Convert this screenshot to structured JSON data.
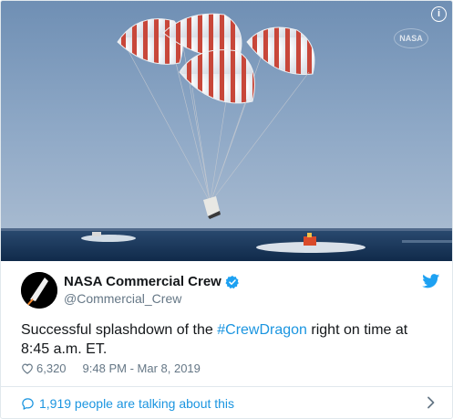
{
  "media": {
    "info_label": "i",
    "watermark_label": "NASA",
    "sky_color": "#8aa5c4",
    "sea_color": "#1a3a5f"
  },
  "author": {
    "name": "NASA Commercial Crew",
    "handle": "@Commercial_Crew",
    "verified": true
  },
  "tweet": {
    "text_before": "Successful splashdown of the ",
    "hashtag": "#CrewDragon",
    "text_after": " right on time at 8:45 a.m. ET."
  },
  "meta": {
    "likes": "6,320",
    "timestamp": "9:48 PM - Mar 8, 2019"
  },
  "footer": {
    "talking_label": "1,919 people are talking about this"
  },
  "colors": {
    "link": "#1b95e0",
    "muted": "#657786",
    "text": "#14171a",
    "twitter_blue": "#1da1f2",
    "chute_red": "#c8473a"
  }
}
